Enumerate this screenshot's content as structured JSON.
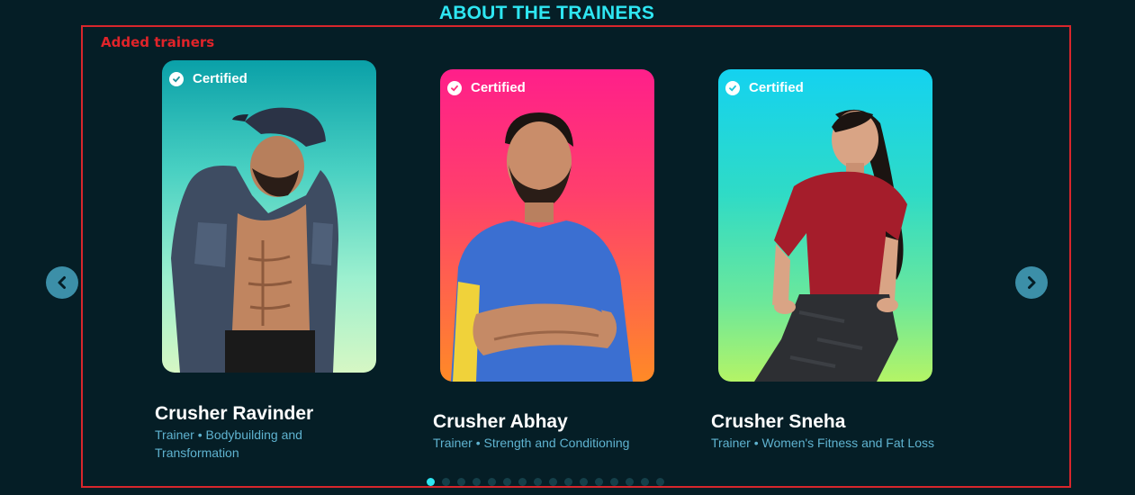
{
  "section": {
    "title": "ABOUT THE TRAINERS",
    "annotation_label": "Added trainers",
    "annotation_color": "#d8262c",
    "accent_color": "#2ee6f2",
    "background_color": "#051e26"
  },
  "carousel": {
    "prev_icon": "chevron-left-icon",
    "next_icon": "chevron-right-icon",
    "total_slides": 16,
    "active_slide": 1
  },
  "trainers": [
    {
      "badge": "Certified",
      "name": "Crusher Ravinder",
      "role": "Trainer • Bodybuilding and Transformation",
      "photo_gradient": [
        "#0aa0a8",
        "#d6f7c4"
      ]
    },
    {
      "badge": "Certified",
      "name": "Crusher Abhay",
      "role": "Trainer • Strength and Conditioning",
      "photo_gradient": [
        "#ff1f8a",
        "#ff8a26"
      ]
    },
    {
      "badge": "Certified",
      "name": "Crusher Sneha",
      "role": "Trainer • Women's Fitness and Fat Loss",
      "photo_gradient": [
        "#14d2f0",
        "#b4f466"
      ]
    }
  ]
}
